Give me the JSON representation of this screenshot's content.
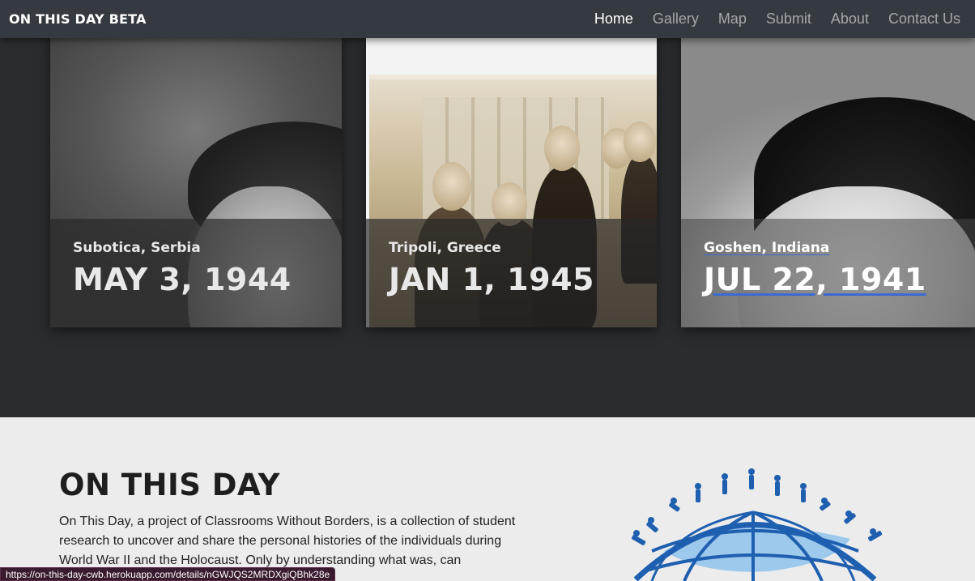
{
  "navbar": {
    "brand": "ON THIS DAY BETA",
    "links": [
      "Home",
      "Gallery",
      "Map",
      "Submit",
      "About",
      "Contact Us"
    ],
    "active": "Home"
  },
  "cards": [
    {
      "place": "Subotica, Serbia",
      "date": "MAY 3, 1944"
    },
    {
      "place": "Tripoli, Greece",
      "date": "JAN 1, 1945"
    },
    {
      "place": "Goshen, Indiana",
      "date": "JUL 22, 1941"
    }
  ],
  "about": {
    "title": "ON THIS DAY",
    "text": "On This Day, a project of Classrooms Without Borders, is a collection of student research to uncover and share the personal histories of the individuals during World War II and the Holocaust. Only by understanding what was, can"
  },
  "status_url": "https://on-this-day-cwb.herokuapp.com/details/nGWJQS2MRDXgiQBhk28e",
  "colors": {
    "navbar": "#343a40",
    "dark_bg": "#2b2c2e",
    "light_bg": "#ececec",
    "logo_blue": "#1f5fb0",
    "link_underline": "#3a6bd1"
  }
}
